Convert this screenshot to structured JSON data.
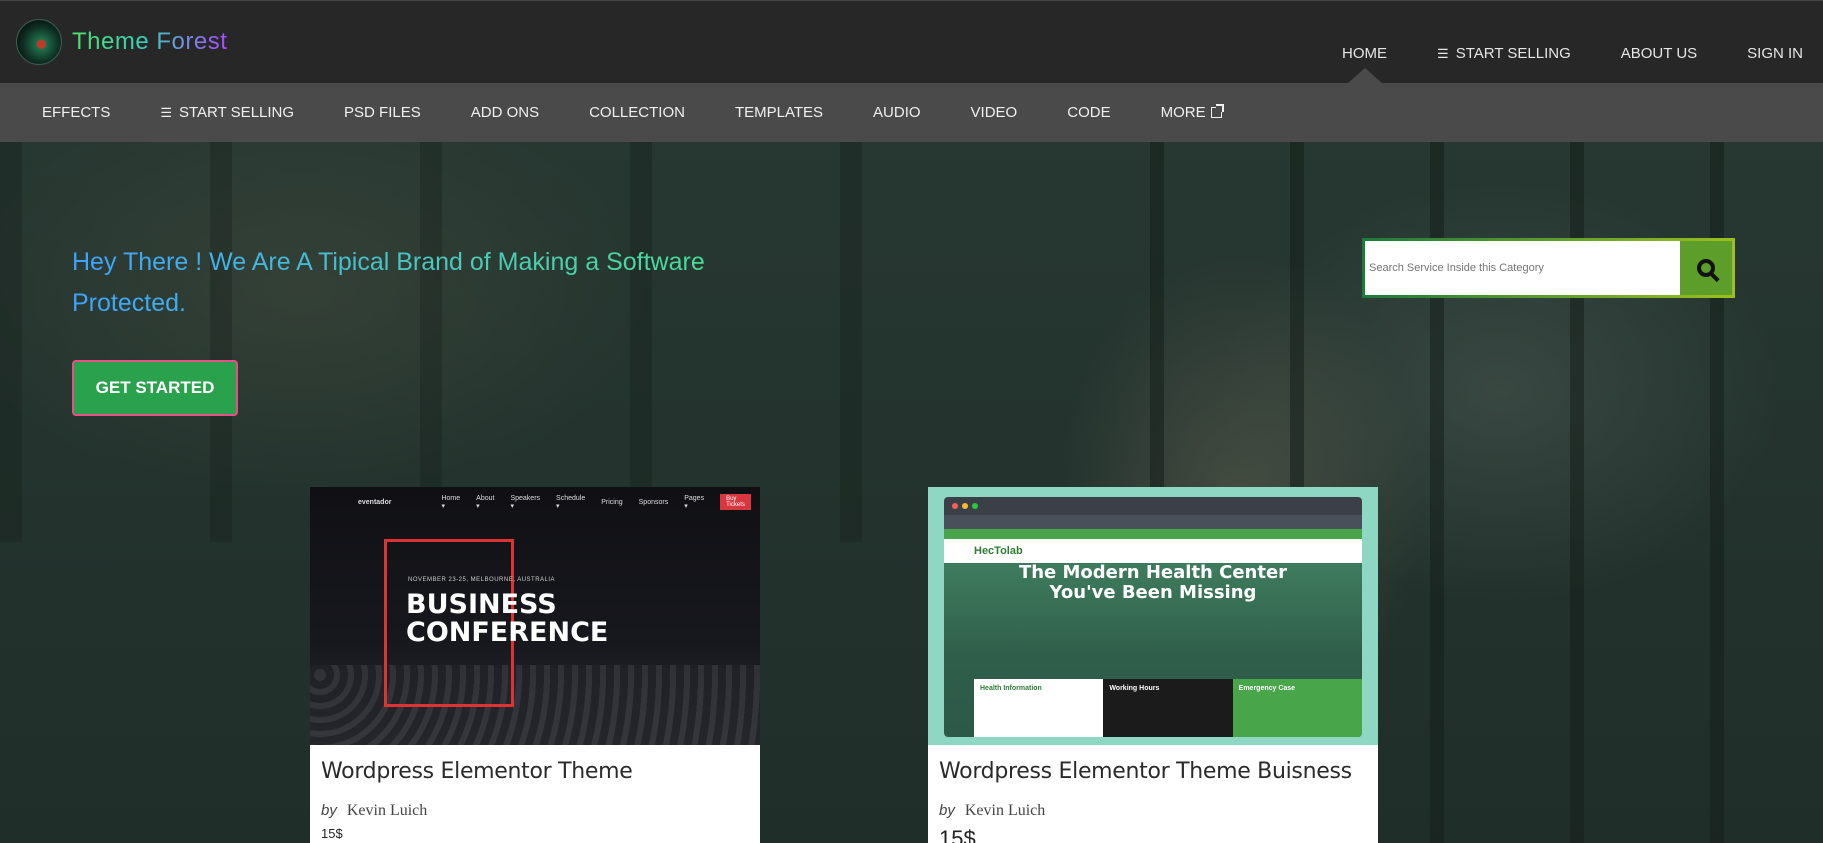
{
  "brand": {
    "name": "Theme Forest"
  },
  "top_nav": [
    {
      "label": "HOME",
      "active": true
    },
    {
      "label": "START SELLING",
      "icon": "menu-icon"
    },
    {
      "label": "ABOUT US"
    },
    {
      "label": "SIGN IN"
    }
  ],
  "sub_nav": [
    {
      "label": "EFFECTS"
    },
    {
      "label": "START SELLING",
      "icon": "menu-icon"
    },
    {
      "label": "PSD FILES"
    },
    {
      "label": "ADD ONS"
    },
    {
      "label": "COLLECTION"
    },
    {
      "label": "TEMPLATES"
    },
    {
      "label": "AUDIO"
    },
    {
      "label": "VIDEO"
    },
    {
      "label": "CODE"
    },
    {
      "label": "MORE",
      "icon": "external-link-icon"
    }
  ],
  "hero": {
    "headline": "Hey There ! We Are A Tipical Brand of Making a Software Protected.",
    "cta_label": "GET STARTED"
  },
  "search": {
    "placeholder": "Search Service Inside this Category",
    "value": ""
  },
  "cards": [
    {
      "title": "Wordpress Elementor Theme",
      "by": "by",
      "author": "Kevin Luich",
      "price": "15$",
      "thumb": {
        "logo": "eventador",
        "nav": [
          "Home ▾",
          "About ▾",
          "Speakers ▾",
          "Schedule ▾",
          "Pricing",
          "Sponsors",
          "Pages ▾"
        ],
        "pill": "Buy Tickets",
        "date": "NOVEMBER 23-25, MELBOURNE, AUSTRALIA",
        "title_line1": "BUSINESS",
        "title_line2": "CONFERENCE"
      }
    },
    {
      "title": "Wordpress Elementor Theme Buisness",
      "by": "by",
      "author": "Kevin Luich",
      "price": "15$",
      "thumb": {
        "logo": "HecTolab",
        "title_line1": "The Modern Health Center",
        "title_line2": "You've Been Missing",
        "panel1": "Health Information",
        "panel2": "Working Hours",
        "panel3": "Emergency Case"
      }
    }
  ],
  "colors": {
    "topbar": "#272727",
    "subnav": "#4a4a4a",
    "cta": "#2aa14c",
    "cta_border": "#e7508b",
    "search_btn": "#5d9e2a"
  }
}
